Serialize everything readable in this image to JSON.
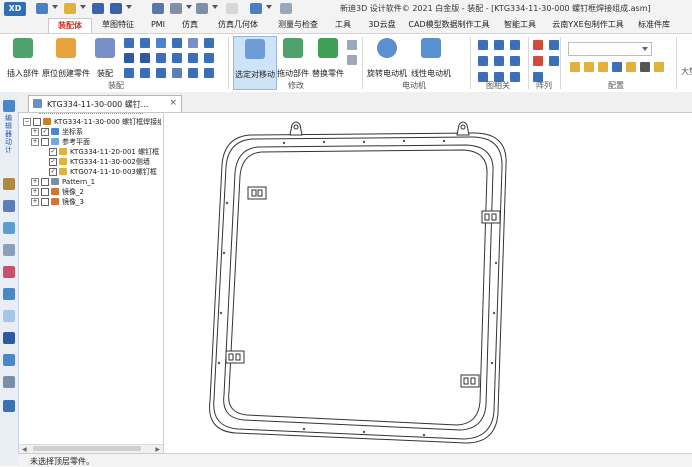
{
  "app": {
    "logo_text": "XD",
    "title": "新迪3D 设计软件© 2021 白金版 - 装配 - [KTG334-11-30-000 螺钉框焊接组成.asm]"
  },
  "tabs": [
    "装配体",
    "草图特征",
    "PMI",
    "仿真",
    "仿真几何体",
    "测量与检查",
    "工具",
    "3D云盘",
    "CAD模型数据制作工具",
    "智能工具",
    "云南YXE包制作工具",
    "标准件库"
  ],
  "ribbon": {
    "insert_part": "插入部件",
    "create_in_place": "原位创建零件",
    "assemble": "装配",
    "group_assembly": "装配",
    "select_move": "选定对移动",
    "drag_part": "拖动部件",
    "replace_part": "替换零件",
    "group_modify": "修改",
    "rotary_motor": "旋转电动机",
    "linear_motor": "线性电动机",
    "group_motor": "电动机",
    "group_pattern_relation": "图相关",
    "group_array": "阵列",
    "group_config": "配置",
    "big": "大垫",
    "config_value": ""
  },
  "left_toolbar_text": "编辑器动计",
  "document_tab": {
    "label": "KTG334-11-30-000 螺钉...",
    "close": "×"
  },
  "tree": [
    {
      "expander": "−",
      "check": false,
      "label": "KTG334-11-30-000 螺钉框焊接组成",
      "icon": "assembly"
    },
    {
      "expander": "+",
      "check": true,
      "label": "坐标系",
      "icon": "coord"
    },
    {
      "expander": "+",
      "check": false,
      "label": "参考平面",
      "icon": "plane"
    },
    {
      "expander": "",
      "check": true,
      "label": "KTG334-11-20-001 螺钉框",
      "icon": "part"
    },
    {
      "expander": "",
      "check": true,
      "label": "KTG334-11-30-002侧墙",
      "icon": "part"
    },
    {
      "expander": "",
      "check": true,
      "label": "KTG074-11-10-003螺钉框",
      "icon": "part"
    },
    {
      "expander": "+",
      "check": false,
      "label": "Pattern_1",
      "icon": "pattern"
    },
    {
      "expander": "+",
      "check": false,
      "label": "镜像_2",
      "icon": "mirror"
    },
    {
      "expander": "+",
      "check": false,
      "label": "镜像_3",
      "icon": "mirror"
    }
  ],
  "status_bar": "未选择顶层零件。",
  "colors": {
    "accent": "#c0392b",
    "selection": "#cfe3f7",
    "frame_stroke": "#333333"
  }
}
